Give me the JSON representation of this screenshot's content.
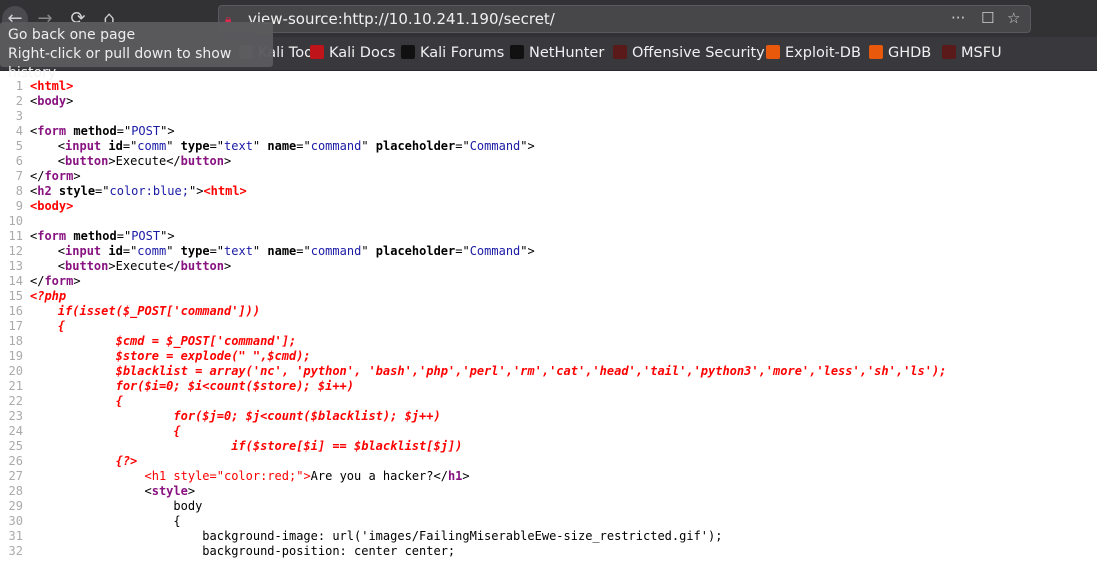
{
  "browser": {
    "url": "view-source:http://10.10.241.190/secret/",
    "tooltip": [
      "Go back one page",
      "Right-click or pull down to show history"
    ],
    "bookmarks": [
      {
        "label": "Kali Tools",
        "icon": "kali-tools-icon",
        "color": "#888"
      },
      {
        "label": "Kali Docs",
        "icon": "kali-docs-icon",
        "color": "#c0141b"
      },
      {
        "label": "Kali Forums",
        "icon": "kali-dragon-icon",
        "color": "#111"
      },
      {
        "label": "NetHunter",
        "icon": "kali-dragon-icon",
        "color": "#111"
      },
      {
        "label": "Offensive Security",
        "icon": "offsec-icon",
        "color": "#5a1a1a"
      },
      {
        "label": "Exploit-DB",
        "icon": "exploit-db-bug-icon",
        "color": "#e8590c"
      },
      {
        "label": "GHDB",
        "icon": "exploit-db-bug-icon",
        "color": "#e8590c"
      },
      {
        "label": "MSFU",
        "icon": "offsec-icon",
        "color": "#5a1a1a"
      }
    ]
  },
  "source_lines": [
    [
      [
        "r",
        "<html>"
      ]
    ],
    [
      [
        "x",
        "<"
      ],
      [
        "t",
        "body"
      ],
      [
        "x",
        ">"
      ]
    ],
    [],
    [
      [
        "x",
        "<"
      ],
      [
        "t",
        "form"
      ],
      [
        "x",
        " "
      ],
      [
        "a",
        "method"
      ],
      [
        "x",
        "=\""
      ],
      [
        "v",
        "POST"
      ],
      [
        "x",
        "\">"
      ]
    ],
    [
      [
        "x",
        "\t<"
      ],
      [
        "t",
        "input"
      ],
      [
        "x",
        " "
      ],
      [
        "a",
        "id"
      ],
      [
        "x",
        "=\""
      ],
      [
        "v",
        "comm"
      ],
      [
        "x",
        "\" "
      ],
      [
        "a",
        "type"
      ],
      [
        "x",
        "=\""
      ],
      [
        "v",
        "text"
      ],
      [
        "x",
        "\" "
      ],
      [
        "a",
        "name"
      ],
      [
        "x",
        "=\""
      ],
      [
        "v",
        "command"
      ],
      [
        "x",
        "\" "
      ],
      [
        "a",
        "placeholder"
      ],
      [
        "x",
        "=\""
      ],
      [
        "v",
        "Command"
      ],
      [
        "x",
        "\">"
      ]
    ],
    [
      [
        "x",
        "\t<"
      ],
      [
        "t",
        "button"
      ],
      [
        "x",
        ">Execute</"
      ],
      [
        "t",
        "button"
      ],
      [
        "x",
        ">"
      ]
    ],
    [
      [
        "x",
        "</"
      ],
      [
        "t",
        "form"
      ],
      [
        "x",
        ">"
      ]
    ],
    [
      [
        "x",
        "<"
      ],
      [
        "t",
        "h2"
      ],
      [
        "x",
        " "
      ],
      [
        "a",
        "style"
      ],
      [
        "x",
        "=\""
      ],
      [
        "v",
        "color:blue;"
      ],
      [
        "x",
        "\">"
      ],
      [
        "r",
        "<html>"
      ]
    ],
    [
      [
        "r",
        "<body>"
      ]
    ],
    [],
    [
      [
        "x",
        "<"
      ],
      [
        "t",
        "form"
      ],
      [
        "x",
        " "
      ],
      [
        "a",
        "method"
      ],
      [
        "x",
        "=\""
      ],
      [
        "v",
        "POST"
      ],
      [
        "x",
        "\">"
      ]
    ],
    [
      [
        "x",
        "\t<"
      ],
      [
        "t",
        "input"
      ],
      [
        "x",
        " "
      ],
      [
        "a",
        "id"
      ],
      [
        "x",
        "=\""
      ],
      [
        "v",
        "comm"
      ],
      [
        "x",
        "\" "
      ],
      [
        "a",
        "type"
      ],
      [
        "x",
        "=\""
      ],
      [
        "v",
        "text"
      ],
      [
        "x",
        "\" "
      ],
      [
        "a",
        "name"
      ],
      [
        "x",
        "=\""
      ],
      [
        "v",
        "command"
      ],
      [
        "x",
        "\" "
      ],
      [
        "a",
        "placeholder"
      ],
      [
        "x",
        "=\""
      ],
      [
        "v",
        "Command"
      ],
      [
        "x",
        "\">"
      ]
    ],
    [
      [
        "x",
        "\t<"
      ],
      [
        "t",
        "button"
      ],
      [
        "x",
        ">Execute</"
      ],
      [
        "t",
        "button"
      ],
      [
        "x",
        ">"
      ]
    ],
    [
      [
        "x",
        "</"
      ],
      [
        "t",
        "form"
      ],
      [
        "x",
        ">"
      ]
    ],
    [
      [
        "p",
        "<?php"
      ]
    ],
    [
      [
        "p",
        "\tif(isset($_POST['command']))"
      ]
    ],
    [
      [
        "p",
        "\t{"
      ]
    ],
    [
      [
        "p",
        "\t\t$cmd = $_POST['command'];"
      ]
    ],
    [
      [
        "p",
        "\t\t$store = explode(\" \",$cmd);"
      ]
    ],
    [
      [
        "p",
        "\t\t$blacklist = array('nc', 'python', 'bash','php','perl','rm','cat','head','tail','python3','more','less','sh','ls');"
      ]
    ],
    [
      [
        "p",
        "\t\tfor($i=0; $i<count($store); $i++)"
      ]
    ],
    [
      [
        "p",
        "\t\t{"
      ]
    ],
    [
      [
        "p",
        "\t\t\tfor($j=0; $j<count($blacklist); $j++)"
      ]
    ],
    [
      [
        "p",
        "\t\t\t{"
      ]
    ],
    [
      [
        "p",
        "\t\t\t\tif($store[$i] == $blacklist[$j])"
      ]
    ],
    [
      [
        "p",
        "\t\t{?>"
      ]
    ],
    [
      [
        "x",
        "\t\t    "
      ],
      [
        "e",
        "<h1 style=\"color:red;\">"
      ],
      [
        "x",
        "Are you a hacker?</"
      ],
      [
        "t",
        "h1"
      ],
      [
        "x",
        ">"
      ]
    ],
    [
      [
        "x",
        "\t\t    <"
      ],
      [
        "t",
        "style"
      ],
      [
        "x",
        ">"
      ]
    ],
    [
      [
        "x",
        "\t\t\tbody"
      ]
    ],
    [
      [
        "x",
        "\t\t\t{"
      ]
    ],
    [
      [
        "x",
        "\t\t\t    background-image: url('images/FailingMiserableEwe-size_restricted.gif');"
      ]
    ],
    [
      [
        "x",
        "\t\t\t    background-position: center center;"
      ]
    ]
  ]
}
